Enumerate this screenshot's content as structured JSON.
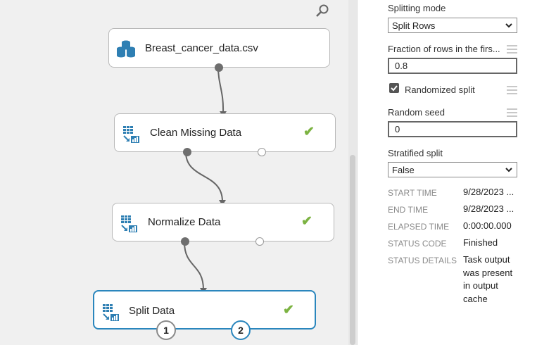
{
  "canvas": {
    "nodes": [
      {
        "label": "Breast_cancer_data.csv",
        "icon": "dataset-icon",
        "status": ""
      },
      {
        "label": "Clean Missing Data",
        "icon": "module-icon",
        "status": "completed"
      },
      {
        "label": "Normalize Data",
        "icon": "module-icon",
        "status": "completed"
      },
      {
        "label": "Split Data",
        "icon": "module-icon",
        "status": "completed"
      }
    ],
    "split_ports": [
      "1",
      "2"
    ],
    "colors": {
      "check": "#7cb342",
      "selected": "#2a86bd",
      "icon": "#2e7fb3"
    }
  },
  "properties": {
    "splitting_mode": {
      "label": "Splitting mode",
      "value": "Split Rows"
    },
    "fraction": {
      "label": "Fraction of rows in the firs...",
      "value": "0.8"
    },
    "randomized": {
      "label": "Randomized split",
      "checked": true
    },
    "random_seed": {
      "label": "Random seed",
      "value": "0"
    },
    "stratified": {
      "label": "Stratified split",
      "value": "False"
    },
    "meta": [
      {
        "key": "START TIME",
        "value": "9/28/2023 ..."
      },
      {
        "key": "END TIME",
        "value": "9/28/2023 ..."
      },
      {
        "key": "ELAPSED TIME",
        "value": "0:00:00.000"
      },
      {
        "key": "STATUS CODE",
        "value": "Finished"
      },
      {
        "key": "STATUS DETAILS",
        "value": "Task output was present in output cache"
      }
    ]
  }
}
